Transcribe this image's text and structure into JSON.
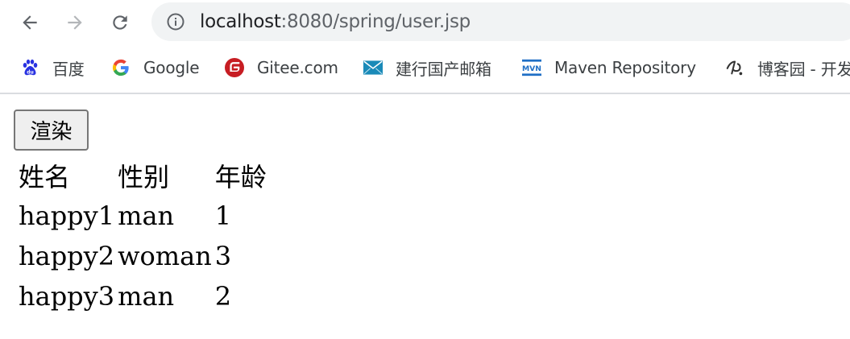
{
  "browser": {
    "url_host": "localhost",
    "url_path": ":8080/spring/user.jsp"
  },
  "bookmarks": [
    {
      "label": "百度",
      "icon": "baidu-paw-icon"
    },
    {
      "label": "Google",
      "icon": "google-g-icon"
    },
    {
      "label": "Gitee.com",
      "icon": "gitee-icon"
    },
    {
      "label": "建行国产邮箱",
      "icon": "mail-envelope-icon"
    },
    {
      "label": "Maven Repository",
      "icon": "maven-mvn-icon"
    },
    {
      "label": "博客园 - 开发",
      "icon": "cnblogs-icon"
    }
  ],
  "page": {
    "render_button": "渲染",
    "table": {
      "headers": [
        "姓名",
        "性别",
        "年龄"
      ],
      "rows": [
        [
          "happy1",
          "man",
          "1"
        ],
        [
          "happy2",
          "woman",
          "3"
        ],
        [
          "happy3",
          "man",
          "2"
        ]
      ]
    }
  }
}
